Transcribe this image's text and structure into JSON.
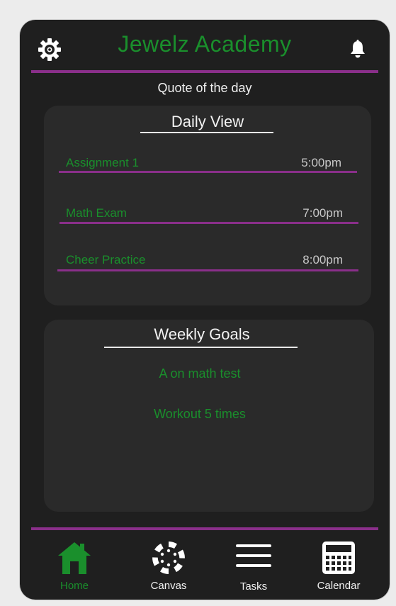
{
  "header": {
    "title": "Jewelz Academy",
    "settings_icon": "gear-icon",
    "notifications_icon": "bell-icon",
    "quote_label": "Quote of the day"
  },
  "daily_view": {
    "title": "Daily View",
    "events": [
      {
        "name": "Assignment 1",
        "time": "5:00pm"
      },
      {
        "name": "Math Exam",
        "time": "7:00pm"
      },
      {
        "name": "Cheer Practice",
        "time": "8:00pm"
      }
    ]
  },
  "weekly_goals": {
    "title": "Weekly Goals",
    "goals": [
      "A on math test",
      "Workout 5 times"
    ]
  },
  "nav": {
    "items": [
      {
        "label": "Home",
        "icon": "home-icon",
        "active": true
      },
      {
        "label": "Canvas",
        "icon": "canvas-icon",
        "active": false
      },
      {
        "label": "Tasks",
        "icon": "menu-icon",
        "active": false
      },
      {
        "label": "Calendar",
        "icon": "calendar-icon",
        "active": false
      }
    ]
  },
  "colors": {
    "background": "#1f1f1f",
    "card": "#2a2a2a",
    "accent_green": "#1a8f2c",
    "accent_purple": "#8a2f8a"
  }
}
